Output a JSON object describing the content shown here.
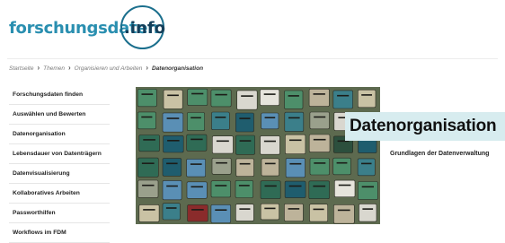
{
  "logo": {
    "text": "forschungsdaten",
    "suffix": ".info"
  },
  "breadcrumb": [
    {
      "label": "Startseite"
    },
    {
      "label": "Themen"
    },
    {
      "label": "Organisieren und Arbeiten"
    },
    {
      "label": "Datenorganisation",
      "current": true
    }
  ],
  "sidebar": {
    "items": [
      {
        "label": "Forschungsdaten finden"
      },
      {
        "label": "Auswählen und Bewerten"
      },
      {
        "label": "Datenorganisation"
      },
      {
        "label": "Lebensdauer von Datenträgern"
      },
      {
        "label": "Datenvisualisierung"
      },
      {
        "label": "Kollaboratives Arbeiten"
      },
      {
        "label": "Passworthilfen"
      },
      {
        "label": "Workflows im FDM"
      }
    ]
  },
  "main": {
    "title": "Datenorganisation",
    "subtitle": "Grundlagen der Datenverwaltung"
  },
  "colors": {
    "brand_blue": "#2a8fb0",
    "brand_dark": "#153f5a",
    "title_bg": "#d7ecef"
  }
}
